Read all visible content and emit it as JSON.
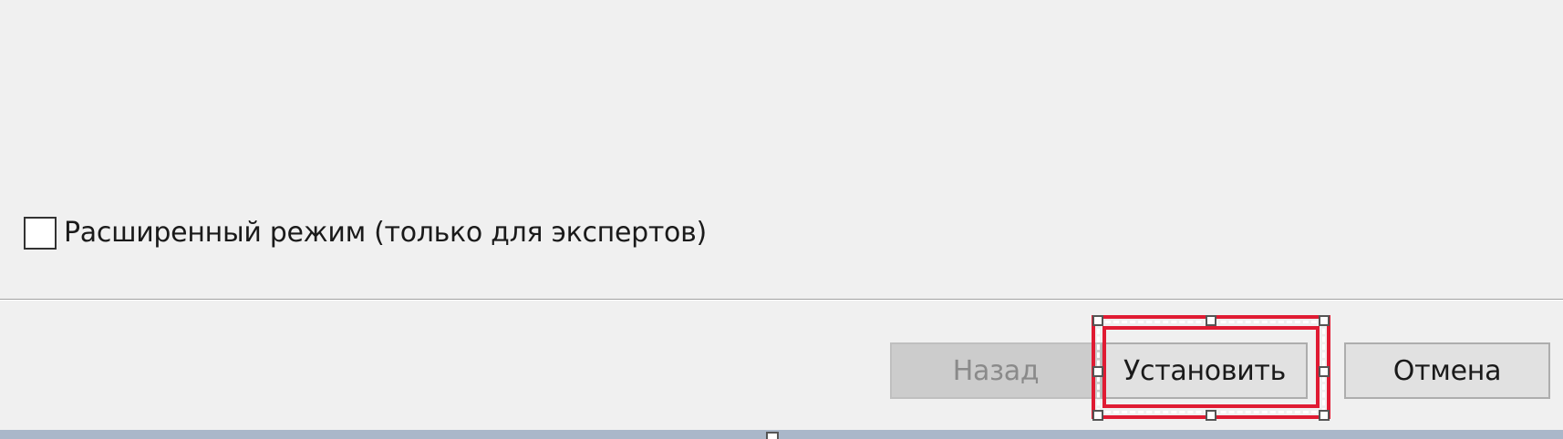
{
  "options": {
    "expert_mode_label": "Расширенный режим (только для экспертов)",
    "expert_mode_checked": false
  },
  "footer": {
    "back_label": "Назад",
    "back_enabled": false,
    "install_label": "Установить",
    "install_selected": true,
    "cancel_label": "Отмена"
  },
  "colors": {
    "window_background": "#f0f0f0",
    "selection_accent": "#e01b33",
    "disabled_text": "#8a8a8a",
    "status_strip": "#aab7c9"
  }
}
